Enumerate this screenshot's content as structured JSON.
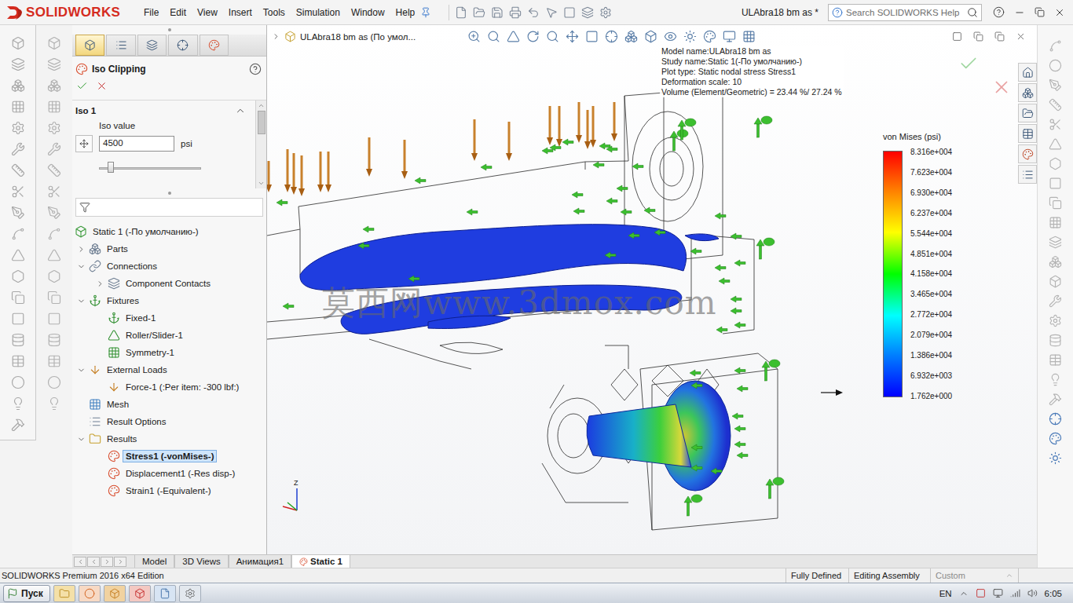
{
  "app": {
    "brand": "SOLIDWORKS",
    "menu": [
      "File",
      "Edit",
      "View",
      "Insert",
      "Tools",
      "Simulation",
      "Window",
      "Help"
    ],
    "title": "ULAbra18 bm as *",
    "search": {
      "placeholder": "Search SOLIDWORKS Help"
    }
  },
  "property_manager": {
    "title": "Iso Clipping",
    "section": {
      "title": "Iso 1",
      "expanded": true
    },
    "field_label": "Iso value",
    "value": "4500",
    "unit": "psi",
    "slider": {
      "level": 0.09
    }
  },
  "tree": {
    "items": [
      {
        "label": "Static 1 (-По умолчанию-)",
        "depth": 0,
        "expandable": false,
        "expanded": false,
        "selected": false,
        "kind": "study"
      },
      {
        "label": "Parts",
        "depth": 1,
        "expandable": true,
        "expanded": false,
        "selected": false,
        "kind": "parts"
      },
      {
        "label": "Connections",
        "depth": 1,
        "expandable": true,
        "expanded": true,
        "selected": false,
        "kind": "connections"
      },
      {
        "label": "Component Contacts",
        "depth": 2,
        "expandable": true,
        "expanded": false,
        "selected": false,
        "kind": "contacts"
      },
      {
        "label": "Fixtures",
        "depth": 1,
        "expandable": true,
        "expanded": true,
        "selected": false,
        "kind": "fixtures"
      },
      {
        "label": "Fixed-1",
        "depth": 2,
        "expandable": false,
        "expanded": false,
        "selected": false,
        "kind": "fixed"
      },
      {
        "label": "Roller/Slider-1",
        "depth": 2,
        "expandable": false,
        "expanded": false,
        "selected": false,
        "kind": "roller"
      },
      {
        "label": "Symmetry-1",
        "depth": 2,
        "expandable": false,
        "expanded": false,
        "selected": false,
        "kind": "symmetry"
      },
      {
        "label": "External Loads",
        "depth": 1,
        "expandable": true,
        "expanded": true,
        "selected": false,
        "kind": "loads"
      },
      {
        "label": "Force-1 (:Per item: -300 lbf:)",
        "depth": 2,
        "expandable": false,
        "expanded": false,
        "selected": false,
        "kind": "force"
      },
      {
        "label": "Mesh",
        "depth": 1,
        "expandable": false,
        "expanded": false,
        "selected": false,
        "kind": "mesh"
      },
      {
        "label": "Result Options",
        "depth": 1,
        "expandable": false,
        "expanded": false,
        "selected": false,
        "kind": "options"
      },
      {
        "label": "Results",
        "depth": 1,
        "expandable": true,
        "expanded": true,
        "selected": false,
        "kind": "results"
      },
      {
        "label": "Stress1 (-vonMises-)",
        "depth": 2,
        "expandable": false,
        "expanded": false,
        "selected": true,
        "kind": "plot"
      },
      {
        "label": "Displacement1 (-Res disp-)",
        "depth": 2,
        "expandable": false,
        "expanded": false,
        "selected": false,
        "kind": "plot"
      },
      {
        "label": "Strain1 (-Equivalent-)",
        "depth": 2,
        "expandable": false,
        "expanded": false,
        "selected": false,
        "kind": "plot"
      }
    ]
  },
  "viewport": {
    "breadcrumb": "ULAbra18 bm as  (По умол...",
    "info": [
      "Model name:ULAbra18 bm as",
      "Study name:Static 1(-По умолчанию-)",
      "Plot type: Static nodal stress Stress1",
      "Deformation scale: 10",
      "Volume (Element/Geometric) = 23.44 %/ 27.24 %"
    ],
    "legend": {
      "title": "von Mises (psi)",
      "ticks": [
        "8.316e+004",
        "7.623e+004",
        "6.930e+004",
        "6.237e+004",
        "5.544e+004",
        "4.851e+004",
        "4.158e+004",
        "3.465e+004",
        "2.772e+004",
        "2.079e+004",
        "1.386e+004",
        "6.932e+003",
        "1.762e+000"
      ]
    },
    "watermark": "莫西网www.3dmox.com",
    "axis": "Z"
  },
  "tabs": [
    {
      "label": "Model",
      "selected": false
    },
    {
      "label": "3D Views",
      "selected": false
    },
    {
      "label": "Анимация1",
      "selected": false
    },
    {
      "label": "Static 1",
      "selected": true
    }
  ],
  "status_bar": {
    "edition": "SOLIDWORKS Premium 2016 x64 Edition",
    "state": "Fully Defined",
    "mode": "Editing Assembly",
    "units": "Custom"
  },
  "taskbar": {
    "start": "Пуск",
    "language": "EN",
    "time": "6:05"
  }
}
